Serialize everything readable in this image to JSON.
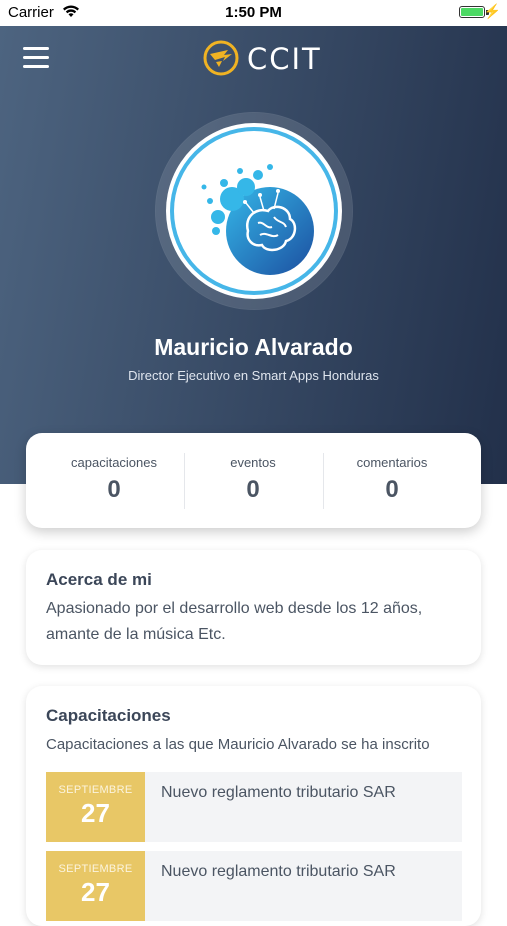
{
  "status_bar": {
    "carrier": "Carrier",
    "time": "1:50 PM",
    "battery_level": 1.0
  },
  "header": {
    "logo_text": "CCIT",
    "menu_icon": "hamburger-icon",
    "logo_icon": "eagle-logo-icon"
  },
  "profile": {
    "name": "Mauricio Alvarado",
    "role": "Director Ejecutivo en Smart Apps Honduras",
    "avatar_icon": "brain-icon"
  },
  "stats": [
    {
      "label": "capacitaciones",
      "value": "0"
    },
    {
      "label": "eventos",
      "value": "0"
    },
    {
      "label": "comentarios",
      "value": "0"
    }
  ],
  "about": {
    "title": "Acerca de mi",
    "text_line1": "Apasionado por el desarrollo web desde los 12 años,",
    "text_line2": "amante de la música Etc."
  },
  "courses": {
    "title": "Capacitaciones",
    "subtitle": "Capacitaciones a las que Mauricio Alvarado se ha inscrito",
    "items": [
      {
        "month": "SEPTIEMBRE",
        "day": "27",
        "title": "Nuevo reglamento tributario SAR"
      },
      {
        "month": "SEPTIEMBRE",
        "day": "27",
        "title": "Nuevo reglamento tributario SAR"
      }
    ]
  },
  "colors": {
    "hero_start": "#4d6480",
    "hero_end": "#22304a",
    "accent_gold": "#e8c766",
    "avatar_blue": "#46b6e8"
  }
}
